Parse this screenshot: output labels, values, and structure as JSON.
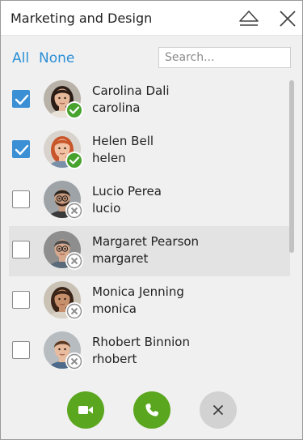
{
  "window": {
    "title": "Marketing and Design"
  },
  "titlebar_icons": {
    "eject": "eject-icon",
    "close": "close-icon"
  },
  "filter": {
    "all_label": "All",
    "none_label": "None",
    "search_placeholder": "Search...",
    "search_value": ""
  },
  "contacts": [
    {
      "name": "Carolina Dali",
      "username": "carolina",
      "checked": true,
      "status": "available",
      "hovered": false
    },
    {
      "name": "Helen Bell",
      "username": "helen",
      "checked": true,
      "status": "available",
      "hovered": false
    },
    {
      "name": "Lucio Perea",
      "username": "lucio",
      "checked": false,
      "status": "offline",
      "hovered": false
    },
    {
      "name": "Margaret Pearson",
      "username": "margaret",
      "checked": false,
      "status": "offline",
      "hovered": true
    },
    {
      "name": "Monica Jenning",
      "username": "monica",
      "checked": false,
      "status": "offline",
      "hovered": false
    },
    {
      "name": "Rhobert Binnion",
      "username": "rhobert",
      "checked": false,
      "status": "offline",
      "hovered": false
    }
  ],
  "actions": {
    "video": "video-camera-icon",
    "call": "phone-icon",
    "cancel": "close-icon"
  },
  "colors": {
    "accent": "#2a8fd6",
    "checkbox": "#3b8fd4",
    "status_available": "#47a32e",
    "status_offline": "#8f8f8f",
    "action_green": "#5aa61e",
    "action_grey": "#d2d2d2"
  }
}
